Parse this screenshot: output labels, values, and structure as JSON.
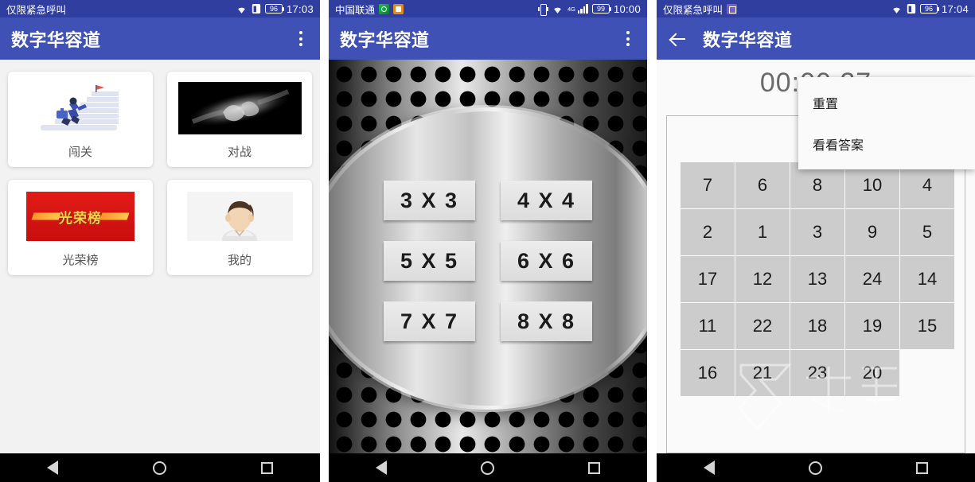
{
  "app": {
    "name": "数字华容道"
  },
  "colors": {
    "statusbar": "#303F9F",
    "appbar": "#3F51B5",
    "tile": "#CCCCCC",
    "page_bg": "#F2F2F2"
  },
  "screen1": {
    "status": {
      "carrier": "仅限紧急呼叫",
      "battery": "96",
      "time": "17:03"
    },
    "appbar": {
      "title": "数字华容道",
      "menu_icon": "overflow-menu-icon"
    },
    "cards": [
      {
        "label": "闯关",
        "image": "stairs-climber-illustration"
      },
      {
        "label": "对战",
        "image": "fist-bump-photo"
      },
      {
        "label": "光荣榜",
        "image": "honor-roll-banner",
        "banner_text": "光荣榜"
      },
      {
        "label": "我的",
        "image": "user-avatar"
      }
    ]
  },
  "screen2": {
    "status": {
      "carrier": "中国联通",
      "network": "4G",
      "battery": "99",
      "time": "10:00"
    },
    "appbar": {
      "title": "数字华容道",
      "menu_icon": "overflow-menu-icon"
    },
    "size_buttons": [
      "3 X 3",
      "4 X 4",
      "5 X 5",
      "6 X 6",
      "7 X 7",
      "8 X 8"
    ]
  },
  "screen3": {
    "status": {
      "carrier": "仅限紧急呼叫",
      "battery": "96",
      "time": "17:04"
    },
    "appbar": {
      "title": "数字华容道",
      "back_icon": "back-arrow-icon"
    },
    "timer": "00:00:27",
    "menu": {
      "items": [
        "重置",
        "看看答案"
      ]
    },
    "watermark": "九游",
    "board": {
      "columns": 5,
      "rows": 5,
      "tiles": [
        "7",
        "6",
        "8",
        "10",
        "4",
        "2",
        "1",
        "3",
        "9",
        "5",
        "17",
        "12",
        "13",
        "24",
        "14",
        "11",
        "22",
        "18",
        "19",
        "15",
        "16",
        "21",
        "23",
        "20",
        ""
      ]
    }
  },
  "navbar": {
    "back": "back-triangle-icon",
    "home": "home-circle-icon",
    "recents": "recents-square-icon"
  }
}
